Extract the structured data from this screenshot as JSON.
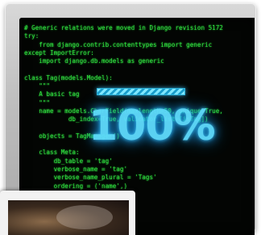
{
  "code_lines": [
    "# Generic relations were moved in Django revision 5172",
    "try:",
    "    from django.contrib.contenttypes import generic",
    "except ImportError:",
    "    import django.db.models as generic",
    "",
    "class Tag(models.Model):",
    "    \"\"\"",
    "    A basic tag",
    "    \"\"\"",
    "    name = models.CharField(maxlength=50, unique=True,",
    "            db_index=True, validator_list=[isTag])",
    "",
    "    objects = TagManager()",
    "",
    "    class Meta:",
    "        db_table = 'tag'",
    "        verbose_name = 'tag'",
    "        verbose_name_plural = 'Tags'",
    "        ordering = ('name',)"
  ],
  "progress": {
    "percent_label": "100%",
    "value": 1.0
  },
  "colors": {
    "code_text": "#2fe83f",
    "screen_bg": "#030503",
    "progress_glow": "#5fdcff"
  }
}
